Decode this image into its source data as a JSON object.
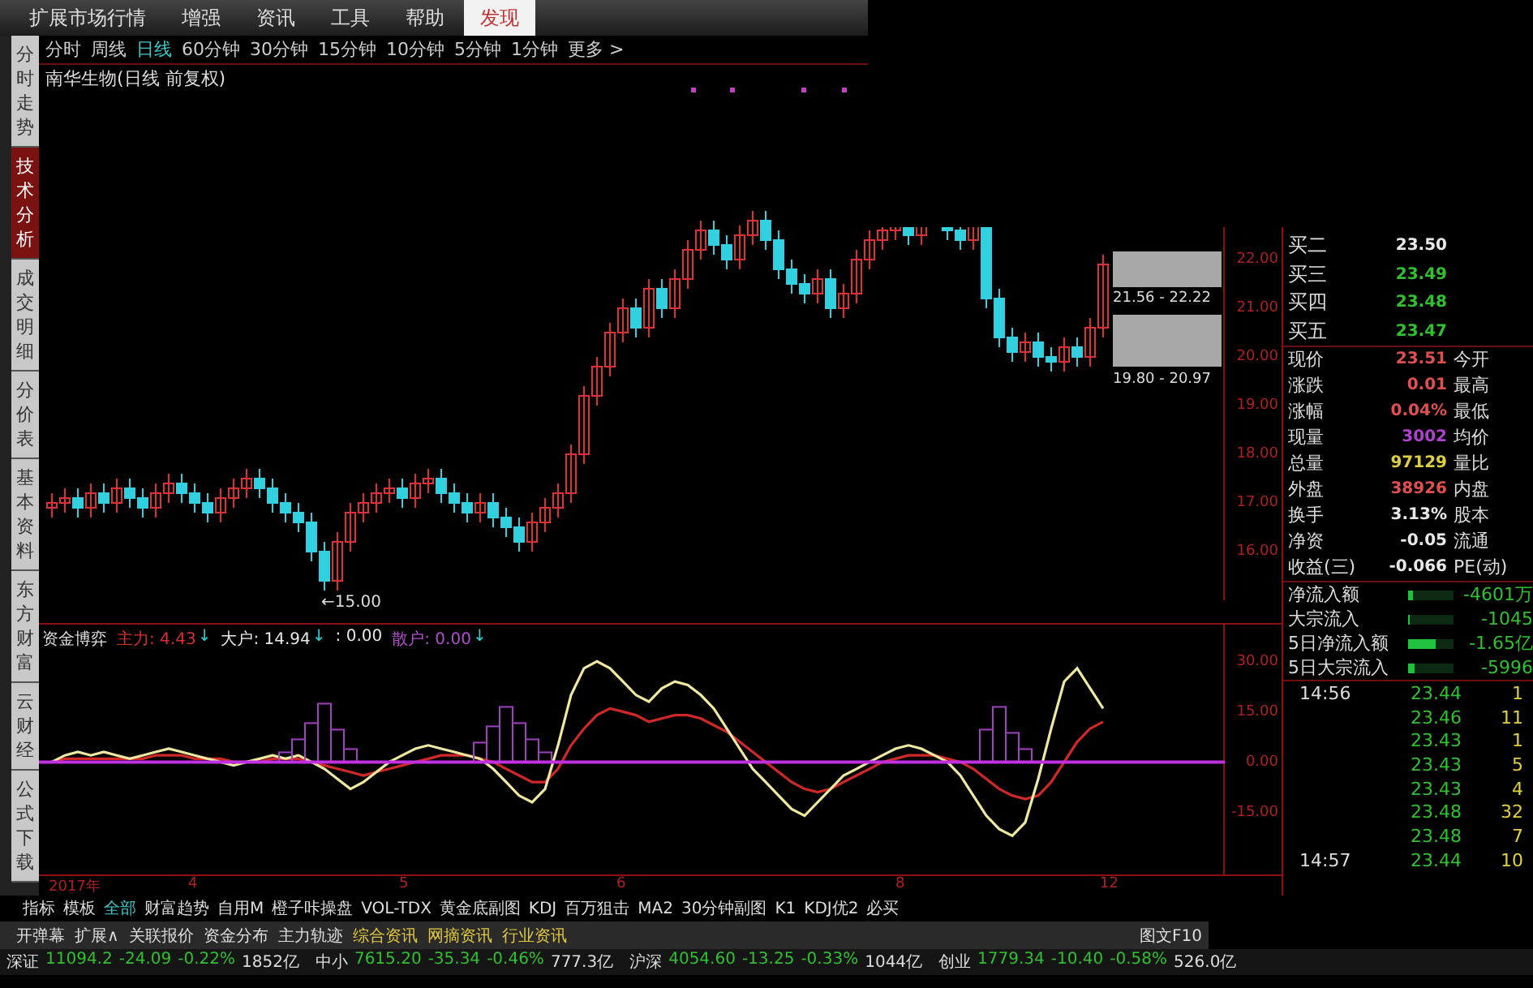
{
  "menu": [
    {
      "label": "扩展市场行情",
      "selected": false
    },
    {
      "label": "增强",
      "selected": false
    },
    {
      "label": "资讯",
      "selected": false
    },
    {
      "label": "工具",
      "selected": false
    },
    {
      "label": "帮助",
      "selected": false
    },
    {
      "label": "发现",
      "selected": true
    }
  ],
  "side_tabs": [
    {
      "label": "分时走势",
      "selected": false
    },
    {
      "label": "技术分析",
      "selected": true
    },
    {
      "label": "成交明细",
      "selected": false
    },
    {
      "label": "分价表",
      "selected": false
    },
    {
      "label": "基本资料",
      "selected": false
    },
    {
      "label": "东方财富",
      "selected": false
    },
    {
      "label": "云财经",
      "selected": false
    },
    {
      "label": "公式下载",
      "selected": false
    }
  ],
  "periods": [
    {
      "label": "分时",
      "selected": false
    },
    {
      "label": "周线",
      "selected": false
    },
    {
      "label": "日线",
      "selected": true
    },
    {
      "label": "60分钟",
      "selected": false
    },
    {
      "label": "30分钟",
      "selected": false
    },
    {
      "label": "15分钟",
      "selected": false
    },
    {
      "label": "10分钟",
      "selected": false
    },
    {
      "label": "5分钟",
      "selected": false
    },
    {
      "label": "1分钟",
      "selected": false
    },
    {
      "label": "更多 >",
      "selected": false
    }
  ],
  "chart": {
    "title": "南华生物(日线 前复权)",
    "y_labels": [
      "22.00",
      "21.00",
      "20.00",
      "19.00",
      "18.00",
      "17.00",
      "16.00"
    ],
    "low_label": "←15.00",
    "range_labels": [
      "21.56 - 22.22",
      "19.80 - 20.97"
    ]
  },
  "indicator": {
    "name": "资金博弈",
    "chart_data": {
      "type": "line",
      "ylim": [
        -34,
        41
      ],
      "yticks": [
        {
          "value": 30,
          "label": "30.00"
        },
        {
          "value": 15,
          "label": "15.00"
        },
        {
          "value": 0,
          "label": "0.00"
        },
        {
          "value": -15,
          "label": "-15.00"
        }
      ],
      "series": [
        {
          "color": "#f0e8a0",
          "values": [
            0,
            2,
            3,
            2,
            3,
            2,
            1,
            2,
            3,
            4,
            3,
            2,
            1,
            0,
            -1,
            0,
            1,
            2,
            1,
            2,
            0,
            -2,
            -5,
            -8,
            -6,
            -3,
            0,
            2,
            4,
            5,
            4,
            3,
            2,
            1,
            -2,
            -6,
            -10,
            -12,
            -8,
            5,
            20,
            28,
            30,
            28,
            24,
            20,
            18,
            22,
            24,
            23,
            20,
            16,
            10,
            4,
            -2,
            -6,
            -10,
            -14,
            -16,
            -12,
            -8,
            -4,
            -2,
            0,
            2,
            4,
            5,
            4,
            2,
            0,
            -4,
            -10,
            -16,
            -20,
            -22,
            -18,
            -5,
            10,
            24,
            28,
            22,
            16
          ]
        },
        {
          "color": "#d02828",
          "values": [
            0,
            1,
            1,
            1,
            1,
            1,
            1,
            1,
            2,
            2,
            2,
            1,
            1,
            1,
            0,
            0,
            0,
            1,
            1,
            1,
            0,
            -1,
            -2,
            -3,
            -4,
            -3,
            -2,
            -1,
            0,
            1,
            2,
            2,
            2,
            1,
            0,
            -2,
            -4,
            -6,
            -6,
            -2,
            5,
            10,
            14,
            16,
            15,
            14,
            12,
            13,
            14,
            14,
            13,
            11,
            9,
            6,
            3,
            0,
            -3,
            -6,
            -8,
            -9,
            -8,
            -6,
            -4,
            -2,
            0,
            1,
            2,
            2,
            2,
            1,
            0,
            -2,
            -5,
            -8,
            -10,
            -11,
            -10,
            -6,
            0,
            6,
            10,
            12
          ]
        }
      ]
    },
    "legend": [
      {
        "label": "主力:",
        "value": "4.43",
        "arrow": "↓",
        "color": "#d83030"
      },
      {
        "label": "大户:",
        "value": "14.94",
        "arrow": "↓",
        "color": "#e8e8e8"
      },
      {
        "label": ":",
        "value": "0.00",
        "color": "#e8e8e8"
      },
      {
        "label": "散户:",
        "value": "0.00",
        "arrow": "↓",
        "color": "#b050d0"
      }
    ]
  },
  "x_labels": [
    "2017年",
    "4",
    "5",
    "6",
    "8",
    "12"
  ],
  "quote": {
    "bids": [
      {
        "label": "买二",
        "value": "23.50",
        "color": "#e8e8e8"
      },
      {
        "label": "买三",
        "value": "23.49",
        "color": "#30c030"
      },
      {
        "label": "买四",
        "value": "23.48",
        "color": "#30c030"
      },
      {
        "label": "买五",
        "value": "23.47",
        "color": "#30c030"
      }
    ],
    "stats": [
      {
        "label": "现价",
        "value": "23.51",
        "color": "#e05050",
        "label_2": "今开"
      },
      {
        "label": "涨跌",
        "value": "0.01",
        "color": "#e05050",
        "label_2": "最高"
      },
      {
        "label": "涨幅",
        "value": "0.04%",
        "color": "#e05050",
        "label_2": "最低"
      },
      {
        "label": "现量",
        "value": "3002",
        "color": "#b040d0",
        "label_2": "均价"
      },
      {
        "label": "总量",
        "value": "97129",
        "color": "#e0d040",
        "label_2": "量比"
      },
      {
        "label": "外盘",
        "value": "38926",
        "color": "#e05050",
        "label_2": "内盘"
      },
      {
        "label": "换手",
        "value": "3.13%",
        "color": "#e8e8e8",
        "label_2": "股本"
      },
      {
        "label": "净资",
        "value": "-0.05",
        "color": "#e8e8e8",
        "label_2": "流通"
      },
      {
        "label": "收益(三)",
        "value": "-0.066",
        "color": "#e8e8e8",
        "label_2": "PE(动)"
      }
    ],
    "flows": [
      {
        "label": "净流入额",
        "value": "-4601万",
        "level": 0.12
      },
      {
        "label": "大宗流入",
        "value": "-1045",
        "level": 0.03
      },
      {
        "label": "5日净流入额",
        "value": "-1.65亿",
        "level": 0.6
      },
      {
        "label": "5日大宗流入",
        "value": "-5996",
        "level": 0.15
      }
    ],
    "ticks": [
      {
        "time": "14:56",
        "price": "23.44",
        "volume": "1"
      },
      {
        "price": "23.46",
        "volume": "11"
      },
      {
        "price": "23.43",
        "volume": "1"
      },
      {
        "price": "23.43",
        "volume": "5"
      },
      {
        "price": "23.43",
        "volume": "4"
      },
      {
        "price": "23.48",
        "volume": "32"
      },
      {
        "price": "23.48",
        "volume": "7"
      },
      {
        "time": "14:57",
        "price": "23.44",
        "volume": "10"
      }
    ]
  },
  "indicator_tabs": [
    {
      "label": "指标",
      "selected": false
    },
    {
      "label": "模板",
      "selected": false
    },
    {
      "label": "全部",
      "selected": true
    },
    {
      "label": "财富趋势",
      "selected": false
    },
    {
      "label": "自用M",
      "selected": false
    },
    {
      "label": "橙子咔操盘",
      "selected": false
    },
    {
      "label": "VOL-TDX",
      "selected": false
    },
    {
      "label": "黄金底副图",
      "selected": false
    },
    {
      "label": "KDJ",
      "selected": false
    },
    {
      "label": "百万狙击",
      "selected": false
    },
    {
      "label": "MA2",
      "selected": false
    },
    {
      "label": "30分钟副图",
      "selected": false
    },
    {
      "label": "K1",
      "selected": false
    },
    {
      "label": "KDJ优2",
      "selected": false
    },
    {
      "label": "必买",
      "selected": false
    }
  ],
  "info_tabs": [
    {
      "label": "开弹幕",
      "highlighted": false
    },
    {
      "label": "扩展∧",
      "highlighted": false
    },
    {
      "label": "关联报价",
      "highlighted": false
    },
    {
      "label": "资金分布",
      "highlighted": false
    },
    {
      "label": "主力轨迹",
      "highlighted": false
    },
    {
      "label": "综合资讯",
      "highlighted": true
    },
    {
      "label": "网摘资讯",
      "highlighted": true
    },
    {
      "label": "行业资讯",
      "highlighted": true
    }
  ],
  "f10_tab": "图文F10",
  "status_bar": [
    {
      "name": "深证",
      "index": "11094.2",
      "change": "-24.09",
      "percent": "-0.22%",
      "turnover": "1852亿"
    },
    {
      "name": "中小",
      "index": "7615.20",
      "change": "-35.34",
      "percent": "-0.46%",
      "turnover": "777.3亿"
    },
    {
      "name": "沪深",
      "index": "4054.60",
      "change": "-13.25",
      "percent": "-0.33%",
      "turnover": "1044亿"
    },
    {
      "name": "创业",
      "index": "1779.34",
      "change": "-10.40",
      "percent": "-0.58%",
      "turnover": "526.0亿"
    }
  ]
}
